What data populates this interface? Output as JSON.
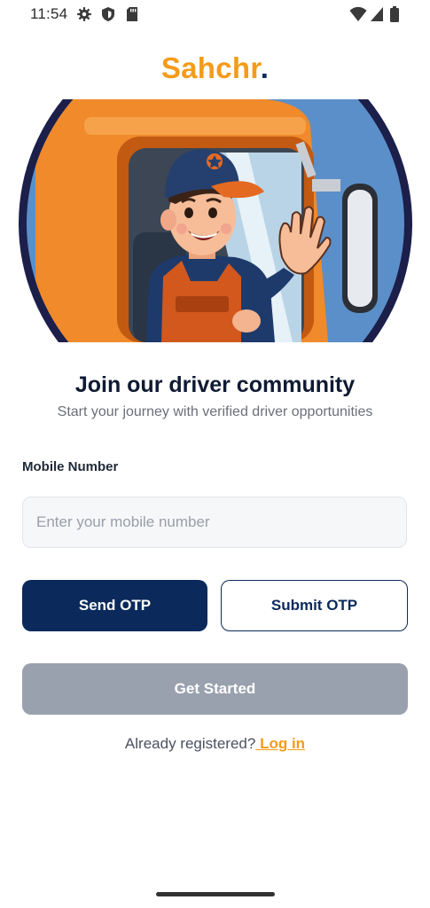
{
  "status_bar": {
    "time": "11:54",
    "left_icons": [
      "settings-icon",
      "shield-icon",
      "sd-card-icon"
    ],
    "right_icons": [
      "wifi-icon",
      "signal-icon",
      "battery-icon"
    ]
  },
  "brand": {
    "name": "Sahchr",
    "dot": ".",
    "color": "#f49b1a",
    "dot_color": "#0d2a5e"
  },
  "hero": {
    "image": "truck-driver-illustration"
  },
  "heading": {
    "title": "Join our driver community",
    "subtitle": "Start your journey with verified driver opportunities"
  },
  "form": {
    "mobile_label": "Mobile Number",
    "mobile_placeholder": "Enter your mobile number",
    "mobile_value": ""
  },
  "actions": {
    "send_otp": "Send OTP",
    "submit_otp": "Submit OTP",
    "get_started": "Get Started"
  },
  "footer": {
    "prompt": "Already registered?",
    "login_link": " Log in"
  },
  "colors": {
    "primary": "#0b2a5b",
    "accent": "#f49b1a",
    "disabled": "#9aa1ae"
  }
}
